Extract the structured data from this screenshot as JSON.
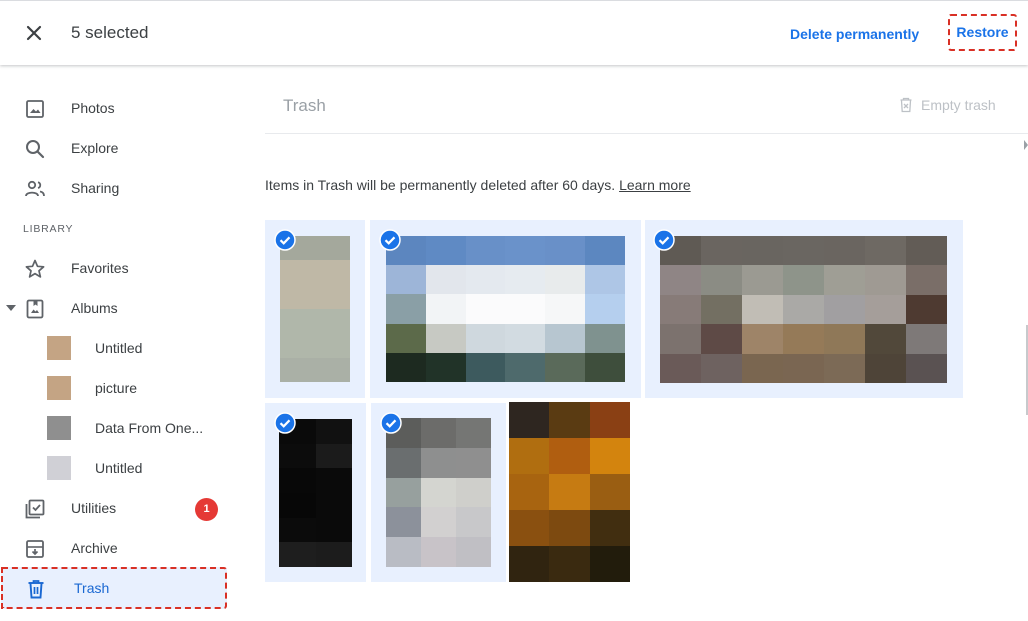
{
  "topbar": {
    "selected_count": "5 selected",
    "delete_permanently": "Delete permanently",
    "restore": "Restore"
  },
  "sidebar": {
    "items": [
      {
        "label": "Photos",
        "icon": "photo-icon"
      },
      {
        "label": "Explore",
        "icon": "search-icon"
      },
      {
        "label": "Sharing",
        "icon": "people-icon"
      }
    ],
    "library_heading": "LIBRARY",
    "library_items": [
      {
        "label": "Favorites",
        "icon": "star-icon"
      },
      {
        "label": "Albums",
        "icon": "album-icon"
      }
    ],
    "albums": [
      {
        "label": "Untitled",
        "color": "#c4a484"
      },
      {
        "label": "picture",
        "color": "#c4a484"
      },
      {
        "label": "Data From One...",
        "color": "#8f8f8f"
      },
      {
        "label": "Untitled",
        "color": "#d0d0d6"
      }
    ],
    "bottom_items": [
      {
        "label": "Utilities",
        "icon": "utilities-icon",
        "badge": "1"
      },
      {
        "label": "Archive",
        "icon": "archive-icon"
      },
      {
        "label": "Trash",
        "icon": "trash-icon",
        "active": true
      }
    ]
  },
  "main": {
    "title": "Trash",
    "empty_trash": "Empty trash",
    "notice": "Items in Trash will be permanently deleted after 60 days.",
    "learn_more": "Learn more"
  },
  "colors": {
    "accent": "#1a73e8",
    "highlight_dash": "#d93025",
    "selected_bg": "#e8f0fe",
    "badge": "#e53935"
  },
  "photos": [
    {
      "selected": true,
      "cols": 1,
      "colors": [
        "#a4a89c",
        "#bfb8a6",
        "#bfb8a6",
        "#b0b7aa",
        "#b0b7aa",
        "#aab0a6"
      ]
    },
    {
      "selected": true,
      "cols": 6,
      "colors": [
        "#5c86bf",
        "#5f8ac4",
        "#6890c8",
        "#6a92ca",
        "#6990c8",
        "#5c87c0",
        "#9db5d8",
        "#e2e6ec",
        "#e4e9ef",
        "#e6ebf0",
        "#e8ebec",
        "#aec6e6",
        "#8a9fa6",
        "#f2f4f6",
        "#fbfbfc",
        "#fbfbfc",
        "#f6f7f8",
        "#b5cfee",
        "#5c6a4a",
        "#c7c9c3",
        "#cfd8de",
        "#d2dbe1",
        "#b7c6d0",
        "#7f928f",
        "#1d2a20",
        "#213328",
        "#3d5a5e",
        "#4e6a6c",
        "#5a6a5a",
        "#3e4e3c"
      ]
    },
    {
      "selected": true,
      "cols": 7,
      "colors": [
        "#5f5a54",
        "#6a6560",
        "#696560",
        "#6a6661",
        "#6a6560",
        "#6e6963",
        "#625c56",
        "#8f8585",
        "#8b8c84",
        "#9b9a92",
        "#8e948a",
        "#9f9e95",
        "#9f9a93",
        "#7a6e68",
        "#877b78",
        "#736f62",
        "#c1bdb5",
        "#aaa9a6",
        "#a19fa1",
        "#a59e9a",
        "#4e3a31",
        "#7c726e",
        "#5e4a46",
        "#9e8468",
        "#957a58",
        "#8f7858",
        "#51483a",
        "#7e7978",
        "#6a5a58",
        "#6e6260",
        "#7a6650",
        "#7a6652",
        "#7c6a56",
        "#4e4438",
        "#5a5252"
      ]
    },
    {
      "selected": true,
      "cols": 2,
      "colors": [
        "#0a0a0a",
        "#111111",
        "#0c0c0c",
        "#1b1b1b",
        "#080808",
        "#0a0a0a",
        "#070707",
        "#0a0a0a",
        "#0b0b0b",
        "#0a0a0a",
        "#1e1e1e",
        "#1c1c1c"
      ]
    },
    {
      "selected": true,
      "cols": 3,
      "colors": [
        "#5c5d5b",
        "#6c6c6a",
        "#757674",
        "#6a6e6f",
        "#8e8f8f",
        "#8f8f8f",
        "#97a09e",
        "#d4d5d0",
        "#cfcfcb",
        "#8c919b",
        "#d2d0d0",
        "#c8c8ca",
        "#b9bcc4",
        "#c8c3c8",
        "#c0bfc4"
      ]
    },
    {
      "selected": false,
      "cols": 3,
      "colors": [
        "#2e2620",
        "#5a3b12",
        "#8a4014",
        "#b06e10",
        "#b05e10",
        "#d3840e",
        "#a86410",
        "#c67b12",
        "#9a5e12",
        "#8a5010",
        "#7d4a10",
        "#412e10",
        "#302410",
        "#3a2a10",
        "#221c0c"
      ]
    }
  ]
}
